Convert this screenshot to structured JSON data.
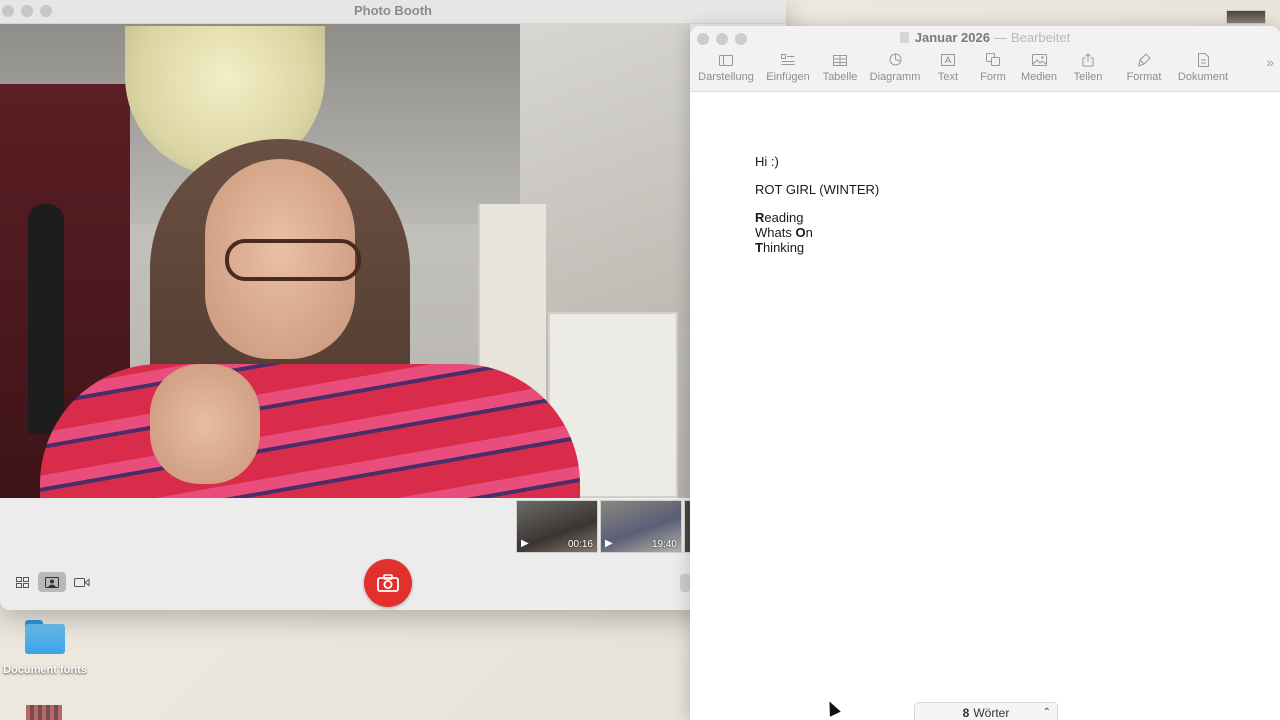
{
  "photo_booth": {
    "title": "Photo Booth",
    "thumbnails": [
      {
        "duration": "00:16"
      },
      {
        "duration": "19:40"
      }
    ]
  },
  "pages": {
    "doc_name": "Januar 2026",
    "separator": "—",
    "status": "Bearbeitet",
    "toolbar": [
      {
        "label": "Darstellung",
        "icon": "sidebar-icon"
      },
      {
        "label": "Einfügen",
        "icon": "insert-icon"
      },
      {
        "label": "Tabelle",
        "icon": "table-icon"
      },
      {
        "label": "Diagramm",
        "icon": "chart-icon"
      },
      {
        "label": "Text",
        "icon": "text-icon"
      },
      {
        "label": "Form",
        "icon": "shape-icon"
      },
      {
        "label": "Medien",
        "icon": "media-icon"
      },
      {
        "label": "Teilen",
        "icon": "share-icon"
      },
      {
        "label": "Format",
        "icon": "format-brush-icon"
      },
      {
        "label": "Dokument",
        "icon": "document-icon"
      }
    ],
    "body": {
      "line1": "Hi :)",
      "line2": "ROT GIRL (WINTER)",
      "acronym": [
        {
          "first": "R",
          "rest": "eading"
        },
        {
          "prefix": "Whats ",
          "first": "O",
          "rest": "n"
        },
        {
          "first": "T",
          "rest": "hinking"
        }
      ]
    },
    "word_count": {
      "number": "8",
      "unit": "Wörter"
    }
  },
  "desktop": {
    "folder_label": "Document fonts"
  }
}
